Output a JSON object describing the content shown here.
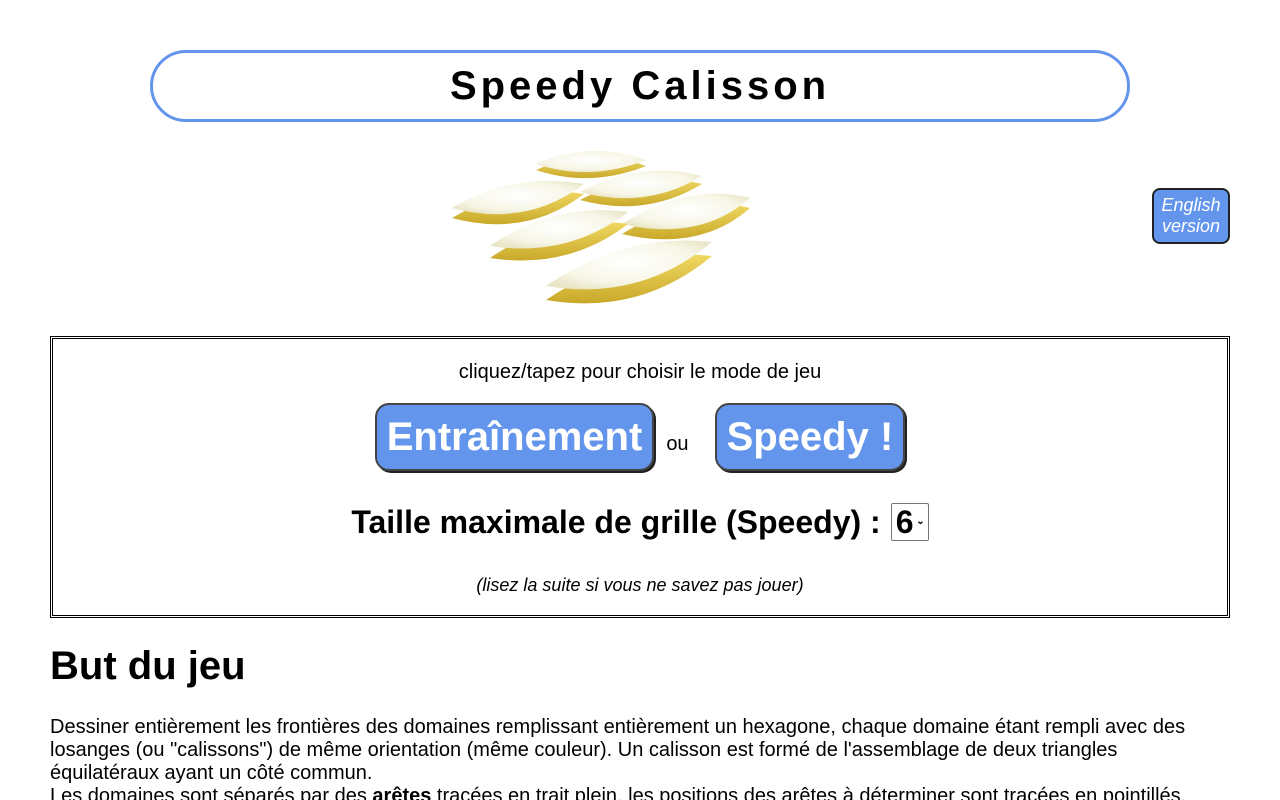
{
  "header": {
    "title": "Speedy Calisson"
  },
  "lang_button": {
    "line1": "English",
    "line2": "version"
  },
  "mode_panel": {
    "hint": "cliquez/tapez pour choisir le mode de jeu",
    "training_label": "Entraînement",
    "or_label": "ou",
    "speedy_label": "Speedy !",
    "grid_size_label": "Taille maximale de grille (Speedy) :",
    "grid_size_value": "6",
    "note": "(lisez la suite si vous ne savez pas jouer)"
  },
  "rules": {
    "title": "But du jeu",
    "para1": "Dessiner entièrement les frontières des domaines remplissant entièrement un hexagone, chaque domaine étant rempli avec des losanges (ou \"calissons\") de même orientation (même couleur). Un calisson est formé de l'assemblage de deux triangles équilatéraux ayant un côté commun.",
    "para2_start": "Les domaines sont séparés par des ",
    "para2_bold": "arêtes",
    "para2_end": " tracées en trait plein, les positions des arêtes à déterminer sont tracées en pointillés."
  },
  "colors": {
    "accent": "#6495ed",
    "text": "#000000",
    "calisson_icing": "#fbfbef",
    "calisson_base": "#e3c84a"
  },
  "image": {
    "subject": "calissons-photo"
  }
}
